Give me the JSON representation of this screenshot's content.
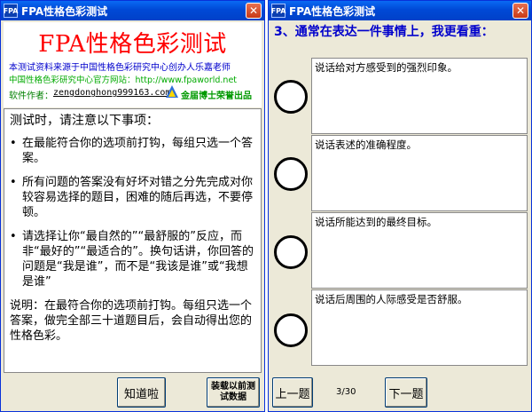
{
  "left_window": {
    "title": "FPA性格色彩测试",
    "icon_text": "FPA",
    "close_label": "✕",
    "banner": {
      "app_title": "FPA性格色彩测试",
      "line1": "本测试资料来源于中国性格色彩研究中心创办人乐嘉老师",
      "line2": "中国性格色彩研究中心官方网站：http://www.fpaworld.net",
      "author_label": "软件作者：",
      "author_email": "zengdonghong999163.com",
      "brand": "金届博士荣誉出品"
    },
    "notice": {
      "title": "测试时，请注意以下事项：",
      "items": [
        "在最能符合你的选项前打钩，每组只选一个答案。",
        "所有问题的答案没有好坏对错之分先完成对你较容易选择的题目，困难的随后再选，不要停顿。",
        "请选择让你“最自然的”“最舒服的”反应，而非“最好的”“最适合的”。换句话讲，你回答的问题是“我是谁”，而不是“我该是谁”或“我想是谁”"
      ],
      "bullet": "•",
      "footer": "说明：在最符合你的选项前打钩。每组只选一个答案，做完全部三十道题目后，会自动得出您的性格色彩。"
    },
    "buttons": {
      "ok": "知道啦",
      "load": "装载以前测试数据"
    }
  },
  "right_window": {
    "title": "FPA性格色彩测试",
    "icon_text": "FPA",
    "close_label": "✕",
    "question": "3、通常在表达一件事情上，我更看重：",
    "answers": [
      "说话给对方感受到的强烈印象。",
      "说话表述的准确程度。",
      "说话所能达到的最终目标。",
      "说话后周围的人际感受是否舒服。"
    ],
    "prev_label": "上一题",
    "page_indicator": "3/30",
    "next_label": "下一题"
  },
  "colors": {
    "title_bar": "#0049d6",
    "app_title": "#ff0000",
    "question": "#0000cc",
    "banner_source": "#0000cc",
    "banner_website": "#00aa00"
  }
}
